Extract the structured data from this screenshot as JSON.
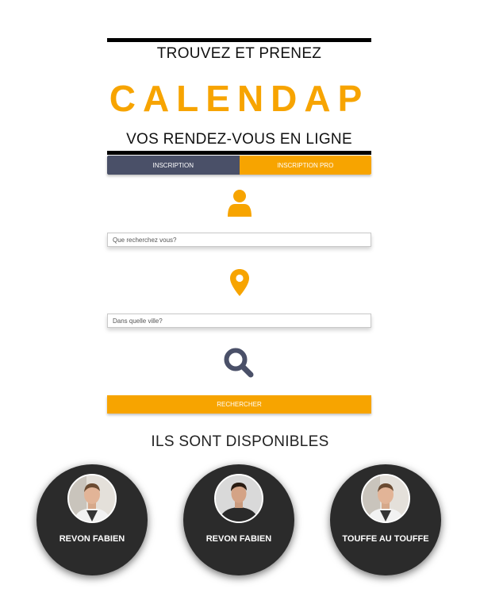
{
  "header": {
    "tagline_top": "TROUVEZ ET PRENEZ",
    "brand": "CALENDAP",
    "tagline_bottom": "VOS RENDEZ-VOUS EN LIGNE"
  },
  "tabs": [
    {
      "label": "INSCRIPTION"
    },
    {
      "label": "INSCRIPTION PRO"
    }
  ],
  "search": {
    "what_placeholder": "Que recherchez vous?",
    "what_value": "",
    "where_placeholder": "Dans quelle ville?",
    "where_value": "",
    "button_label": "RECHERCHER"
  },
  "icons": {
    "user": "user-icon",
    "location": "map-pin-icon",
    "search": "magnifier-icon"
  },
  "available": {
    "title": "ILS SONT DISPONIBLES",
    "pros": [
      {
        "name": "REVON FABIEN"
      },
      {
        "name": "REVON FABIEN"
      },
      {
        "name": "TOUFFE AU TOUFFE"
      }
    ]
  },
  "colors": {
    "accent": "#f7a400",
    "slate": "#4a5068",
    "dark_card": "#2b2b2b"
  }
}
